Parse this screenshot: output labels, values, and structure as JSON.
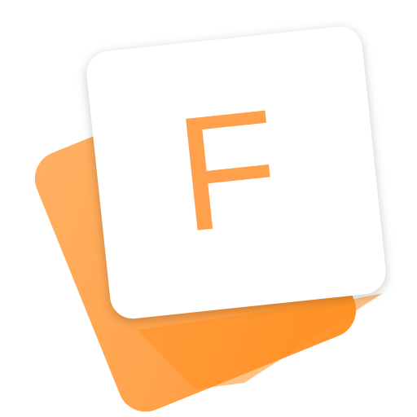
{
  "app_icon": {
    "letter": "F",
    "colors": {
      "card_back_light": "#FFAA58",
      "card_back_dark": "#FF9226",
      "card_front": "#FFFFFF",
      "letter": "#FFA04D"
    }
  }
}
